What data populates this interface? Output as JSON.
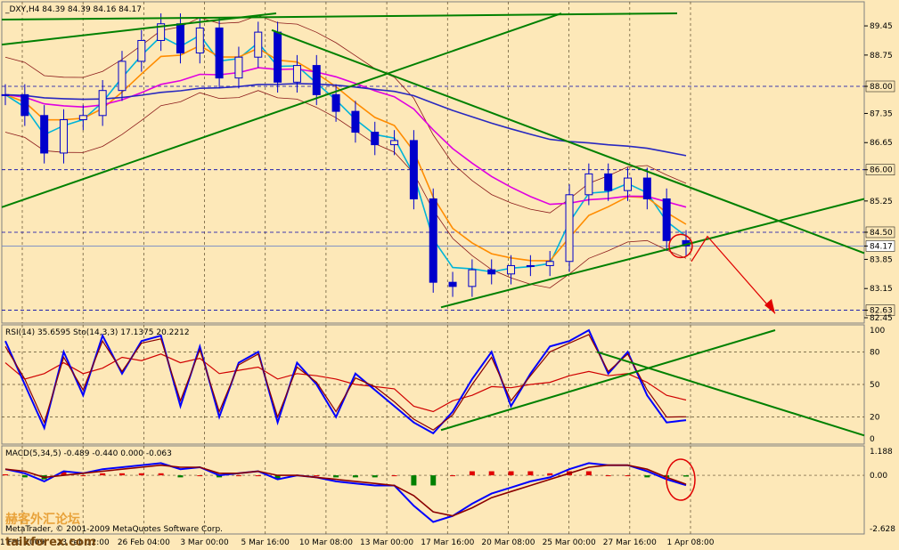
{
  "chart_data": [
    {
      "type": "candlestick",
      "title": "_DXY,H4  84.39 84.39 84.16 84.17",
      "symbol": "_DXY",
      "timeframe": "H4",
      "ohlc": {
        "open": 84.39,
        "high": 84.39,
        "low": 84.16,
        "close": 84.17
      },
      "y_ticks": [
        "89.45",
        "88.75",
        "88.00",
        "87.35",
        "86.65",
        "86.00",
        "85.25",
        "84.50",
        "84.17",
        "83.85",
        "83.15",
        "82.63",
        "82.45"
      ],
      "highlighted_levels": [
        "88.00",
        "86.00",
        "84.50",
        "84.17",
        "82.63"
      ],
      "ylim": [
        82.45,
        89.9
      ],
      "x_ticks": [
        "1 Feb 2009",
        "23 Feb 12:00",
        "26 Feb 04:00",
        "3 Mar 00:00",
        "5 Mar 16:00",
        "10 Mar 08:00",
        "13 Mar 00:00",
        "17 Mar 16:00",
        "20 Mar 08:00",
        "25 Mar 00:00",
        "27 Mar 16:00",
        "1 Apr 08:00"
      ],
      "series": [
        {
          "values": [
            87.8,
            87.3,
            86.4,
            87.2,
            87.3,
            87.9,
            88.6,
            89.1,
            89.5,
            88.8,
            89.4,
            88.2,
            88.7,
            89.3,
            88.1,
            88.5,
            87.8,
            87.4,
            86.9,
            86.6,
            86.7,
            85.3,
            83.3,
            83.2,
            83.6,
            83.5,
            83.7,
            83.7,
            83.8,
            85.4,
            85.9,
            85.5,
            85.8,
            85.3,
            84.3,
            84.17
          ]
        }
      ],
      "indicators": [
        "moving averages",
        "Bollinger Bands"
      ]
    },
    {
      "type": "line",
      "title": "RSI(14) 35.6595  Sto(14,3,3) 17.1375 20.2212",
      "y_ticks": [
        "100",
        "80",
        "50",
        "20",
        "0"
      ],
      "ylim": [
        0,
        100
      ],
      "series": [
        {
          "values": [
            70,
            55,
            60,
            70,
            60,
            65,
            75,
            72,
            78,
            70,
            74,
            60,
            63,
            66,
            55,
            60,
            58,
            55,
            50,
            48,
            46,
            30,
            25,
            35,
            40,
            48,
            47,
            50,
            52,
            58,
            62,
            58,
            60,
            52,
            40,
            35.66
          ]
        },
        {
          "values": [
            90,
            50,
            10,
            80,
            40,
            95,
            60,
            90,
            95,
            30,
            85,
            20,
            70,
            80,
            15,
            70,
            50,
            20,
            60,
            45,
            30,
            15,
            5,
            25,
            55,
            80,
            30,
            60,
            85,
            90,
            100,
            60,
            80,
            40,
            15,
            17.14
          ]
        },
        {
          "values": [
            85,
            55,
            15,
            75,
            45,
            90,
            62,
            88,
            92,
            35,
            82,
            25,
            68,
            78,
            20,
            66,
            52,
            25,
            56,
            48,
            34,
            18,
            8,
            22,
            50,
            75,
            35,
            58,
            80,
            88,
            96,
            62,
            78,
            45,
            20,
            20.22
          ]
        }
      ]
    },
    {
      "type": "bar",
      "title": "MACD(5,34,5) -0.489 -0.440 0.000 -0.063",
      "y_ticks": [
        "1.188",
        "0.00",
        "-2.628"
      ],
      "ylim": [
        -2.628,
        1.188
      ],
      "series": [
        {
          "values": [
            0.3,
            0.1,
            -0.3,
            0.2,
            0.1,
            0.3,
            0.4,
            0.5,
            0.6,
            0.3,
            0.4,
            0.0,
            0.1,
            0.2,
            -0.2,
            0.0,
            -0.1,
            -0.3,
            -0.4,
            -0.5,
            -0.5,
            -1.5,
            -2.3,
            -2.0,
            -1.4,
            -0.9,
            -0.6,
            -0.3,
            -0.1,
            0.3,
            0.6,
            0.5,
            0.5,
            0.2,
            -0.2,
            -0.489
          ]
        },
        {
          "values": [
            0.3,
            0.2,
            -0.1,
            0.0,
            0.1,
            0.2,
            0.3,
            0.4,
            0.5,
            0.4,
            0.4,
            0.1,
            0.1,
            0.2,
            0.0,
            0.0,
            -0.1,
            -0.2,
            -0.3,
            -0.4,
            -0.5,
            -1.0,
            -1.8,
            -2.0,
            -1.6,
            -1.1,
            -0.8,
            -0.5,
            -0.2,
            0.1,
            0.4,
            0.5,
            0.5,
            0.3,
            -0.1,
            -0.44
          ]
        },
        {
          "values": [
            0.05,
            -0.1,
            -0.2,
            0.2,
            0.0,
            0.1,
            0.1,
            0.1,
            0.1,
            -0.1,
            0.0,
            -0.1,
            0.0,
            0.0,
            -0.2,
            0.0,
            0.0,
            -0.1,
            -0.1,
            -0.1,
            0.0,
            -0.5,
            -0.5,
            0.0,
            0.2,
            0.2,
            0.2,
            0.2,
            0.1,
            0.2,
            0.2,
            0.0,
            0.0,
            -0.1,
            -0.1,
            -0.063
          ]
        }
      ]
    }
  ],
  "watermark": {
    "cn": "赫客外汇论坛",
    "en": "taikforex.com",
    "copyright": "MetaTrader, © 2001-2009 MetaQuotes Software Corp."
  },
  "colors": {
    "background": "#FDE8B8",
    "trendline": "#008000",
    "candle": "#0000CC",
    "ma_fast": "#00B4D8",
    "ma_orange": "#FF8C00",
    "ma_magenta": "#E000E0",
    "ma_blue": "#2828C0",
    "bollinger": "#8B1A1A",
    "annotation": "#E00000",
    "rsi": "#D00000",
    "stoch_main": "#0000FF",
    "stoch_signal": "#8B0000"
  }
}
